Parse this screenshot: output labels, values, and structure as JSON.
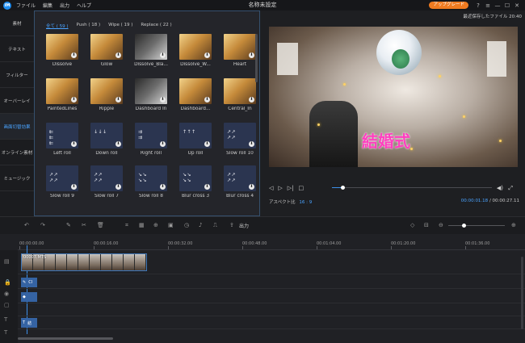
{
  "titlebar": {
    "logo": "iM",
    "menu": [
      "ファイル",
      "編集",
      "出力",
      "ヘルプ"
    ],
    "title": "名称未設定",
    "upgrade_label": "アップグレード",
    "controls": [
      "?",
      "≡",
      "—",
      "☐",
      "✕"
    ]
  },
  "sidebar": {
    "items": [
      {
        "label": "素材"
      },
      {
        "label": "テキスト"
      },
      {
        "label": "フィルター"
      },
      {
        "label": "オーバーレイ"
      },
      {
        "label": "画面切替効果"
      },
      {
        "label": "オンライン素材"
      },
      {
        "label": "ミュージック"
      }
    ],
    "active_index": 4
  },
  "effects": {
    "tabs": [
      "全て ( 59 )",
      "Push ( 18 )",
      "Wipe ( 19 )",
      "Replace ( 22 )"
    ],
    "active_tab": 0,
    "rows": [
      [
        "Dissolve",
        "Glow",
        "Dissolve_Bla...",
        "Dissolve_W...",
        "Heart"
      ],
      [
        "PaintedLines",
        "Ripple",
        "Dashboard In",
        "Dashboard...",
        "Central_In"
      ],
      [
        "Left roll",
        "Down roll",
        "Right roll",
        "Up roll",
        "Slow roll 10"
      ],
      [
        "Slow roll 9",
        "Slow roll 7",
        "Slow roll 8",
        "Blur cross 3",
        "Blur cross 4"
      ]
    ],
    "download_glyph": "⬇"
  },
  "preview": {
    "autosave": "最近保存したファイル 20:40",
    "overlay_text": "結婚式",
    "aspect_label": "アスペクト比",
    "aspect_value": "16 : 9",
    "current_time": "00:00:01.18",
    "total_time": "00:00:27.11",
    "progress_fraction": 0.065
  },
  "toolbar": {
    "export_label": "出力",
    "zoom_fraction": 0.27
  },
  "timeline": {
    "ticks": [
      "00:00:00.00",
      "00:00:16.00",
      "00:00:32.00",
      "00:00:48.00",
      "00:01:04.00",
      "00:01:20.00",
      "00:01:36.00"
    ],
    "clip_name": "00007.MTS",
    "mini_fx_label": "Cl",
    "text_clip_label": "結"
  }
}
